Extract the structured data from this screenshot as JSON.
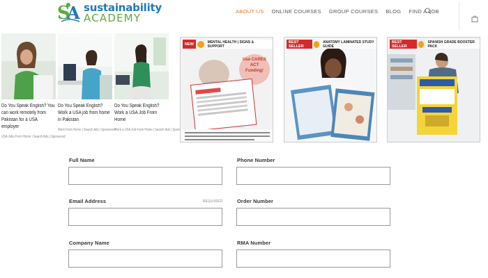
{
  "header": {
    "logo_line1": "sustainability",
    "logo_line2": "ACADEMY",
    "nav": [
      "ABOUT US",
      "ONLINE COURSES",
      "GROUP COURSES",
      "BLOG",
      "FIND A JOB"
    ],
    "active_nav": "ABOUT US",
    "accent_color": "#e07a2c"
  },
  "ads": [
    {
      "title": "Do You Speak English? You can work remotely from Pakistan for a USA employer",
      "source": "USA Jobs From Home | Search Ads | Sponsored"
    },
    {
      "title": "Do You Speak English? Work a USA job from home in Pakistan",
      "source": "Work From Home | Search Ads | Sponsored"
    },
    {
      "title": "Do You Speak English? Work a USA Job From Home",
      "source": "Work a USA Job From Home | Search Ads | Sponsored"
    }
  ],
  "books": [
    {
      "badge": "NEW",
      "title": "MENTAL HEALTH | SIGNS & SUPPORT",
      "note": "Use CARES ACT Funding!"
    },
    {
      "badge": "BEST SELLER",
      "title": "ANATOMY LAMINATED STUDY GUIDE"
    },
    {
      "badge": "BEST SELLER",
      "title": "SPANISH GRADE BOOSTER PACK"
    }
  ],
  "form": {
    "full_name": "Full Name",
    "phone_number": "Phone Number",
    "email_address": "Email Address",
    "required": "REQUIRED",
    "order_number": "Order Number",
    "company_name": "Company Name",
    "rma_number": "RMA Number"
  }
}
